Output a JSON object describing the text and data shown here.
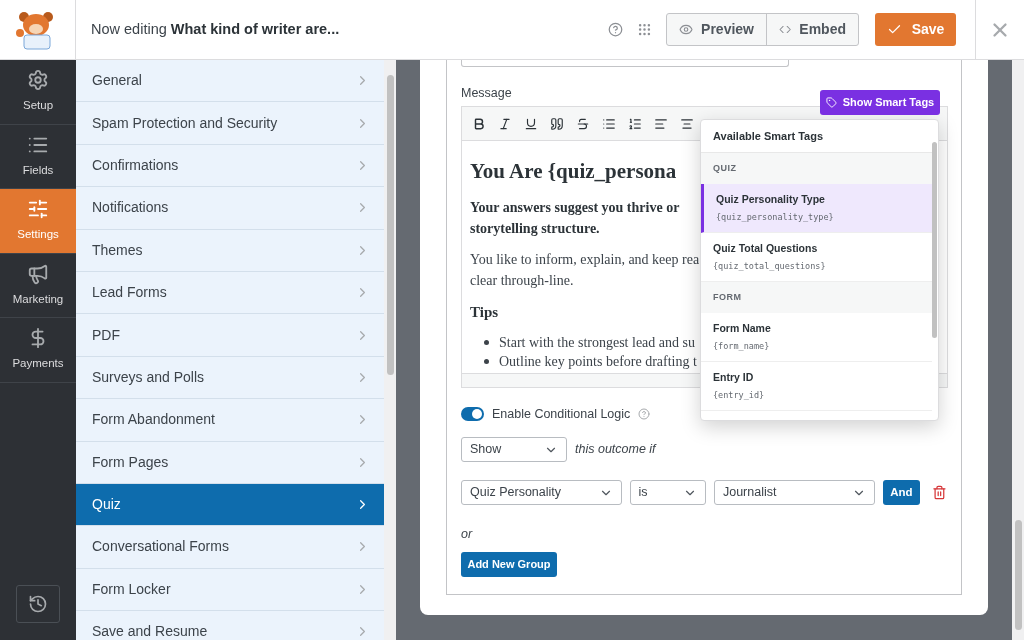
{
  "header": {
    "prefix": "Now editing",
    "title": "What kind of writer are...",
    "preview": "Preview",
    "embed": "Embed",
    "save": "Save"
  },
  "rail": [
    {
      "label": "Setup",
      "selected": false
    },
    {
      "label": "Fields",
      "selected": false
    },
    {
      "label": "Settings",
      "selected": true
    },
    {
      "label": "Marketing",
      "selected": false
    },
    {
      "label": "Payments",
      "selected": false
    }
  ],
  "settings_menu": [
    {
      "label": "General",
      "selected": false
    },
    {
      "label": "Spam Protection and Security",
      "selected": false
    },
    {
      "label": "Confirmations",
      "selected": false
    },
    {
      "label": "Notifications",
      "selected": false
    },
    {
      "label": "Themes",
      "selected": false
    },
    {
      "label": "Lead Forms",
      "selected": false
    },
    {
      "label": "PDF",
      "selected": false
    },
    {
      "label": "Surveys and Polls",
      "selected": false
    },
    {
      "label": "Form Abandonment",
      "selected": false
    },
    {
      "label": "Form Pages",
      "selected": false
    },
    {
      "label": "Quiz",
      "selected": true
    },
    {
      "label": "Conversational Forms",
      "selected": false
    },
    {
      "label": "Form Locker",
      "selected": false
    },
    {
      "label": "Save and Resume",
      "selected": false
    }
  ],
  "message": {
    "label": "Message",
    "smart_tags_button": "Show Smart Tags",
    "content": [
      {
        "kind": "heading",
        "lines": [
          "You Are {quiz_persona"
        ]
      },
      {
        "kind": "strong",
        "lines": [
          "Your answers suggest you thrive or",
          "storytelling structure."
        ]
      },
      {
        "kind": "paragraph",
        "lines": [
          "You like to inform, explain, and keep rea",
          "clear through-line."
        ]
      },
      {
        "kind": "subheading",
        "lines": [
          "Tips"
        ]
      },
      {
        "kind": "bullet",
        "lines": [
          "Start with the strongest lead and su"
        ]
      },
      {
        "kind": "bullet",
        "lines": [
          "Outline key points before drafting t"
        ]
      }
    ]
  },
  "smart_tags": {
    "title": "Available Smart Tags",
    "groups": [
      {
        "label": "QUIZ",
        "items": [
          {
            "name": "Quiz Personality Type",
            "tag": "{quiz_personality_type}",
            "selected": true
          },
          {
            "name": "Quiz Total Questions",
            "tag": "{quiz_total_questions}",
            "selected": false
          }
        ]
      },
      {
        "label": "FORM",
        "items": [
          {
            "name": "Form Name",
            "tag": "{form_name}",
            "selected": false
          },
          {
            "name": "Entry ID",
            "tag": "{entry_id}",
            "selected": false
          }
        ]
      }
    ]
  },
  "conditional_logic": {
    "label": "Enable Conditional Logic",
    "on": true,
    "action": "Show",
    "action_suffix": "this outcome if",
    "rule": {
      "field": "Quiz Personality",
      "operator": "is",
      "value": "Journalist",
      "and_button": "And"
    },
    "or_label": "or",
    "add_group_button": "Add New Group"
  }
}
